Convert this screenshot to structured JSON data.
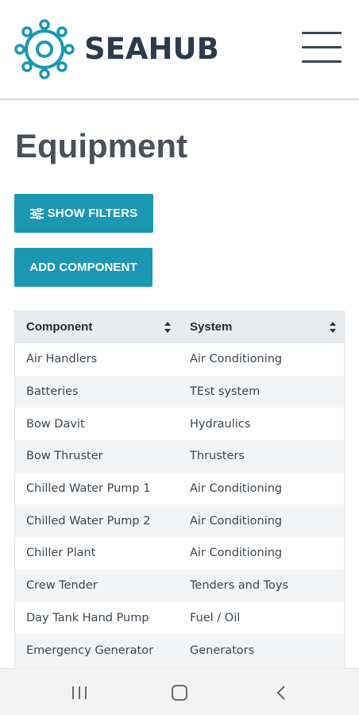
{
  "header": {
    "brand": "SEAHUB",
    "logo_icon": "helm-wheel-icon",
    "menu_icon": "hamburger-menu-icon"
  },
  "page": {
    "title": "Equipment"
  },
  "actions": {
    "show_filters_label": "SHOW FILTERS",
    "show_filters_icon": "sliders-icon",
    "add_component_label": "ADD COMPONENT"
  },
  "table": {
    "columns": [
      {
        "label": "Component",
        "sort_icon": "sort-icon"
      },
      {
        "label": "System",
        "sort_icon": "sort-icon"
      }
    ],
    "rows": [
      {
        "component": "Air Handlers",
        "system": "Air Conditioning"
      },
      {
        "component": "Batteries",
        "system": "TEst system"
      },
      {
        "component": "Bow Davit",
        "system": "Hydraulics"
      },
      {
        "component": "Bow Thruster",
        "system": "Thrusters"
      },
      {
        "component": "Chilled Water Pump 1",
        "system": "Air Conditioning"
      },
      {
        "component": "Chilled Water Pump 2",
        "system": "Air Conditioning"
      },
      {
        "component": "Chiller Plant",
        "system": "Air Conditioning"
      },
      {
        "component": "Crew Tender",
        "system": "Tenders and Toys"
      },
      {
        "component": "Day Tank Hand Pump",
        "system": "Fuel / Oil"
      },
      {
        "component": "Emergency Generator",
        "system": "Generators"
      }
    ]
  },
  "system_nav": [
    "recent-apps-icon",
    "home-icon",
    "back-icon"
  ],
  "colors": {
    "accent": "#1b97b3",
    "brand_text": "#2b3b4d"
  }
}
